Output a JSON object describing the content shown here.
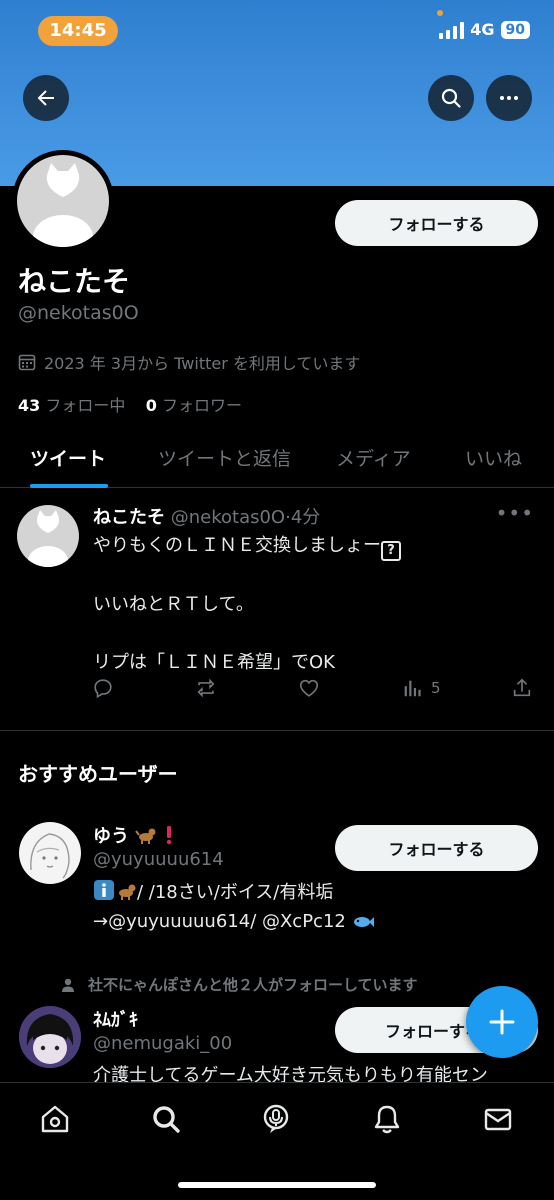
{
  "status_bar": {
    "time": "14:45",
    "network": "4G",
    "battery": "90"
  },
  "header": {
    "back_icon": "arrow-left-icon",
    "search_icon": "search-icon",
    "more_icon": "more-horizontal-icon"
  },
  "profile": {
    "name": "ねこたそ",
    "handle": "@nekotas0O",
    "joined": "2023 年 3月から Twitter を利用しています",
    "following_count": "43",
    "following_label": "フォロー中",
    "followers_count": "0",
    "followers_label": "フォロワー",
    "follow_button": "フォローする"
  },
  "tabs": [
    {
      "label": "ツイート",
      "active": true
    },
    {
      "label": "ツイートと返信",
      "active": false
    },
    {
      "label": "メディア",
      "active": false
    },
    {
      "label": "いいね",
      "active": false
    }
  ],
  "tweet": {
    "name": "ねこたそ",
    "handle": "@nekotas0O",
    "time": "·4分",
    "line1": "やりもくのＬＩＮＥ交換しましょー",
    "line1_badge": "?",
    "line2": "いいねとＲＴして。",
    "line3": "リプは「ＬＩＮＥ希望」でOK",
    "views": "5"
  },
  "recommended": {
    "title": "おすすめユーザー",
    "users": [
      {
        "name": "ゆう",
        "handle": "@yuyuuuu614",
        "bio_line1": "/ /18さい/ボイス/有料垢",
        "bio_line2": "→@yuyuuuuu614/ @XcPc12",
        "follow_button": "フォローする"
      },
      {
        "social_context": "社不にゃんぽさんと他２人がフォローしています",
        "name": "ﾈﾑｶﾞｷ",
        "handle": "@nemugaki_00",
        "bio_line1": "介護士してるゲーム大好き元気もりもり有能セン",
        "follow_button": "フォローする"
      }
    ]
  },
  "colors": {
    "accent": "#1d9bf0",
    "banner": "#4a9be6",
    "muted": "#71767b",
    "status_pill": "#f1a23a"
  }
}
